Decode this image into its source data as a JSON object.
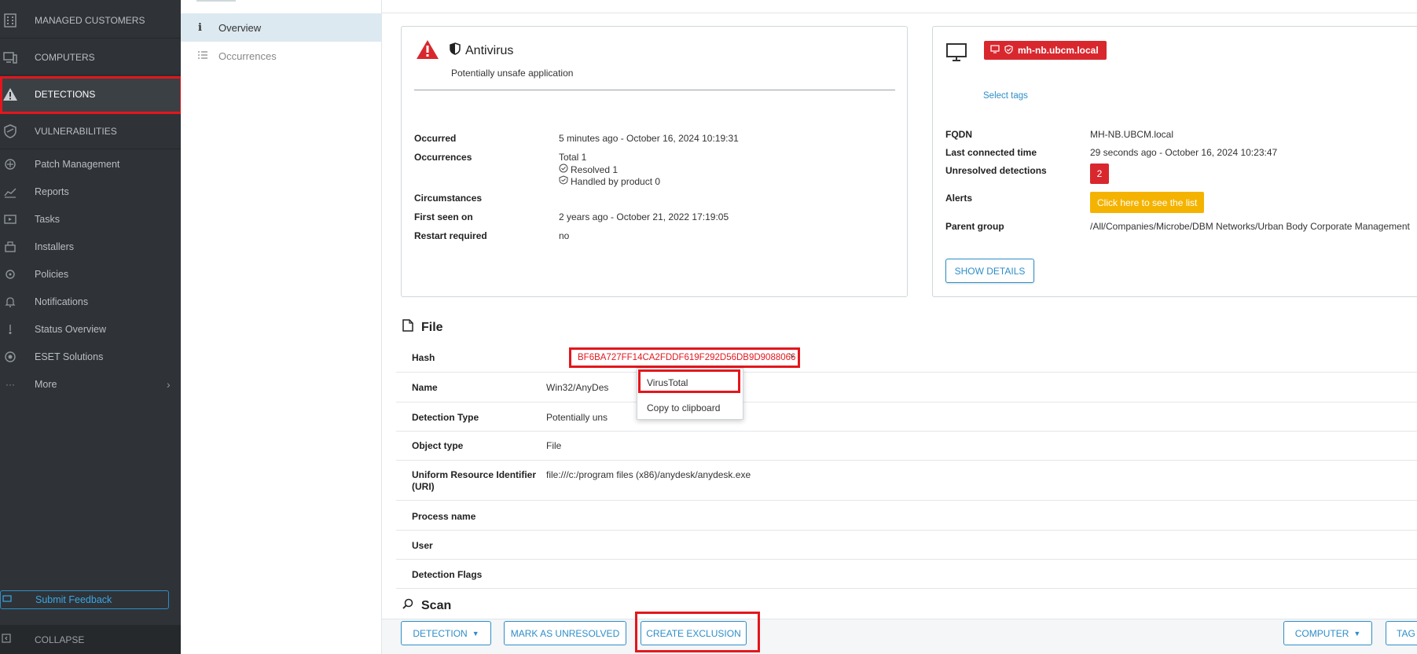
{
  "sidebar": {
    "items": [
      {
        "label": "MANAGED CUSTOMERS",
        "icon": "building-icon"
      },
      {
        "label": "COMPUTERS",
        "icon": "computers-icon"
      },
      {
        "label": "DETECTIONS",
        "icon": "warning-icon"
      },
      {
        "label": "VULNERABILITIES",
        "icon": "shield-icon"
      },
      {
        "label": "Patch Management",
        "icon": "patch-icon"
      },
      {
        "label": "Reports",
        "icon": "reports-icon"
      },
      {
        "label": "Tasks",
        "icon": "tasks-icon"
      },
      {
        "label": "Installers",
        "icon": "installers-icon"
      },
      {
        "label": "Policies",
        "icon": "policies-icon"
      },
      {
        "label": "Notifications",
        "icon": "bell-icon"
      },
      {
        "label": "Status Overview",
        "icon": "status-icon"
      },
      {
        "label": "ESET Solutions",
        "icon": "eset-icon"
      },
      {
        "label": "More",
        "icon": "more-icon"
      }
    ],
    "feedback_label": "Submit Feedback",
    "collapse_label": "COLLAPSE"
  },
  "subnav": {
    "items": [
      {
        "label": "Overview",
        "icon": "info-icon"
      },
      {
        "label": "Occurrences",
        "icon": "list-icon"
      }
    ]
  },
  "detection": {
    "category": "Antivirus",
    "subtitle": "Potentially unsafe application",
    "fields": {
      "occurred_label": "Occurred",
      "occurred_value": "5 minutes ago - October 16, 2024 10:19:31",
      "occurrences_label": "Occurrences",
      "occurrences_total": "Total 1",
      "occurrences_resolved": "Resolved 1",
      "occurrences_handled": "Handled by product 0",
      "circumstances_label": "Circumstances",
      "first_seen_label": "First seen on",
      "first_seen_value": "2 years ago - October 21, 2022 17:19:05",
      "restart_label": "Restart required",
      "restart_value": "no"
    }
  },
  "computer": {
    "hostname": "mh-nb.ubcm.local",
    "select_tags": "Select tags",
    "fqdn_label": "FQDN",
    "fqdn_value": "MH-NB.UBCM.local",
    "last_connected_label": "Last connected time",
    "last_connected_value": "29 seconds ago - October 16, 2024 10:23:47",
    "unresolved_label": "Unresolved detections",
    "unresolved_count": "2",
    "alerts_label": "Alerts",
    "alerts_button": "Click here to see the list",
    "parent_group_label": "Parent group",
    "parent_group_value": "/All/Companies/Microbe/DBM Networks/Urban Body Corporate Management",
    "show_details": "SHOW DETAILS"
  },
  "file": {
    "title": "File",
    "rows": [
      {
        "label": "Hash",
        "value": "BF6BA727FF14CA2FDDF619F292D56DB9D9088066"
      },
      {
        "label": "Name",
        "value": "Win32/AnyDes"
      },
      {
        "label": "Detection Type",
        "value": "Potentially uns"
      },
      {
        "label": "Object type",
        "value": "File"
      },
      {
        "label": "Uniform Resource Identifier",
        "label2": "(URI)",
        "value": "file:///c:/program files (x86)/anydesk/anydesk.exe"
      },
      {
        "label": "Process name",
        "value": ""
      },
      {
        "label": "User",
        "value": ""
      },
      {
        "label": "Detection Flags",
        "value": ""
      }
    ],
    "context_menu": [
      "VirusTotal",
      "Copy to clipboard"
    ]
  },
  "scan": {
    "title": "Scan"
  },
  "actions": {
    "detection": "DETECTION",
    "mark_unresolved": "MARK AS UNRESOLVED",
    "create_exclusion": "CREATE EXCLUSION",
    "computer": "COMPUTER",
    "tag": "TAG"
  },
  "colors": {
    "sidebar_bg": "#2f3337",
    "accent_blue": "#2d8ec9",
    "alert_red": "#d9272e",
    "highlight_red": "#e4161d",
    "alert_yellow": "#f5b301"
  }
}
